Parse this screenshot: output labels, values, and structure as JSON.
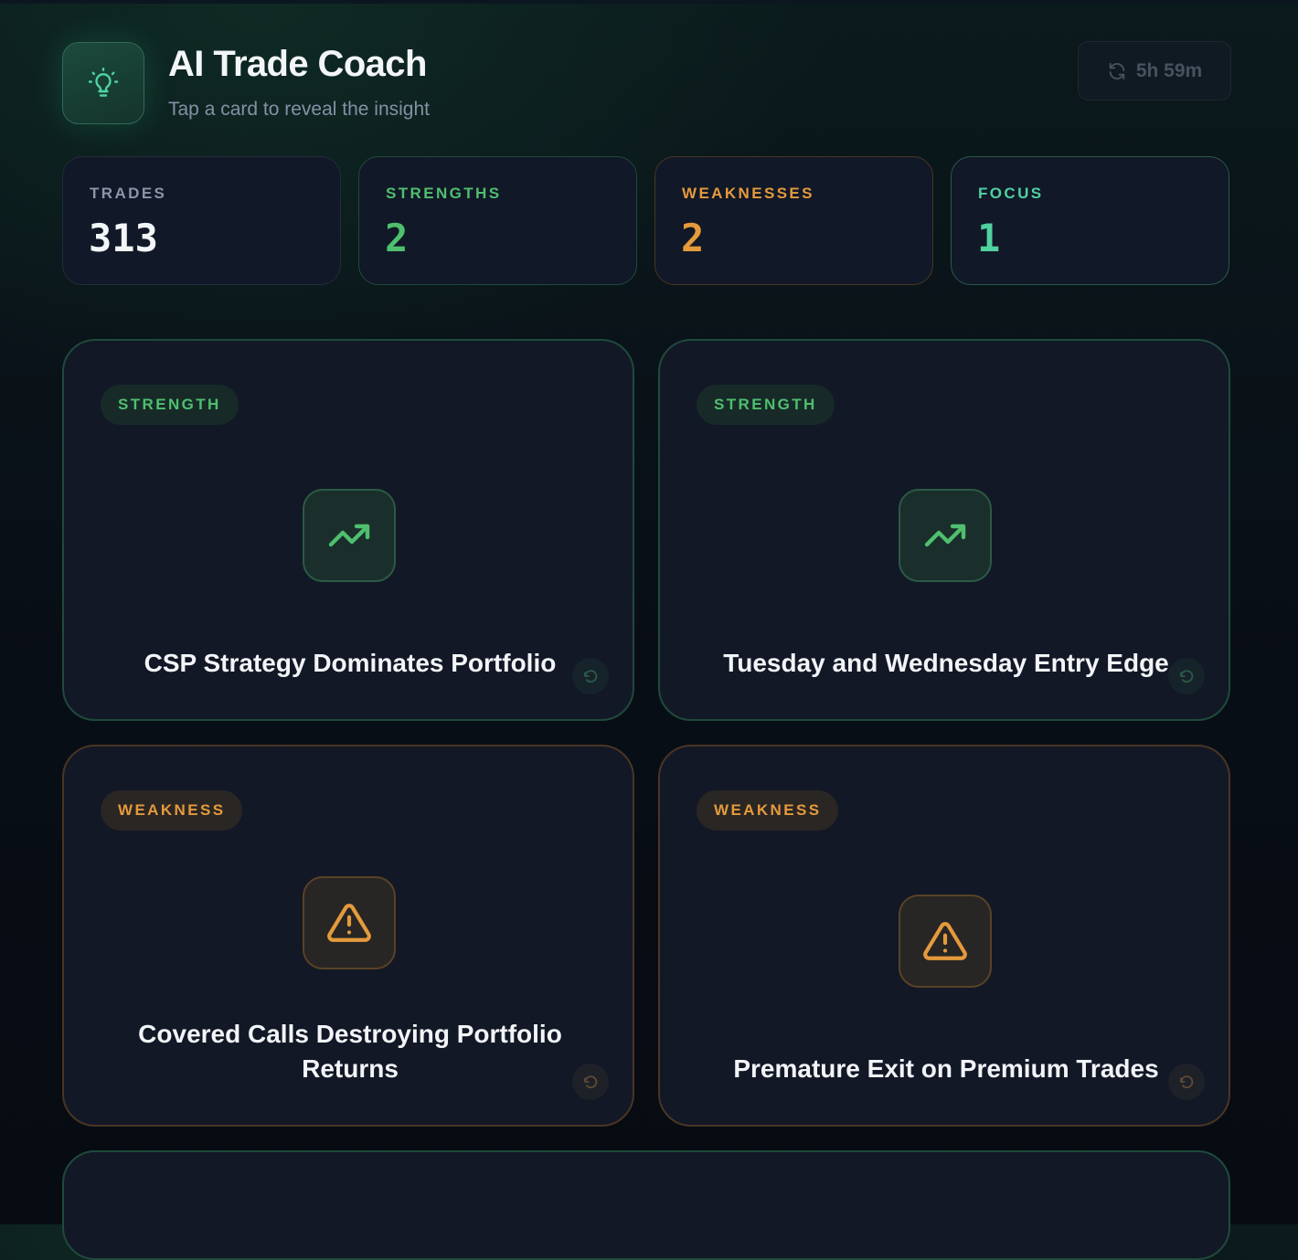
{
  "header": {
    "title": "AI Trade Coach",
    "subtitle": "Tap a card to reveal the insight",
    "logo_icon": "lightbulb-icon",
    "refresh": {
      "icon": "refresh-icon",
      "label": "5h 59m"
    }
  },
  "stats": [
    {
      "label": "TRADES",
      "value": "313",
      "color": "#f3f6f9",
      "label_color": "#8b96a8",
      "border": "#232c3a"
    },
    {
      "label": "STRENGTHS",
      "value": "2",
      "color": "#4fbf6f",
      "label_color": "#4fbf6f",
      "border": "#1f4a3b"
    },
    {
      "label": "WEAKNESSES",
      "value": "2",
      "color": "#e59a3c",
      "label_color": "#e59a3c",
      "border": "#4a3524"
    },
    {
      "label": "FOCUS",
      "value": "1",
      "color": "#4fd1a0",
      "label_color": "#4fd1a0",
      "border": "#2a5a4b"
    }
  ],
  "cards": [
    {
      "type": "STRENGTH",
      "title": "CSP Strategy Dominates Portfolio",
      "icon": "trending-up-icon",
      "flip_icon": "undo-icon"
    },
    {
      "type": "STRENGTH",
      "title": "Tuesday and Wednesday Entry Edge",
      "icon": "trending-up-icon",
      "flip_icon": "undo-icon"
    },
    {
      "type": "WEAKNESS",
      "title": "Covered Calls Destroying Portfolio Returns",
      "icon": "warning-triangle-icon",
      "flip_icon": "undo-icon"
    },
    {
      "type": "WEAKNESS",
      "title": "Premature Exit on Premium Trades",
      "icon": "warning-triangle-icon",
      "flip_icon": "undo-icon"
    }
  ],
  "colors": {
    "accent_green": "#4fbf6f",
    "accent_amber": "#e59a3c",
    "accent_teal": "#4fd1a0",
    "card_background": "#121826",
    "page_background": "#090f17"
  }
}
